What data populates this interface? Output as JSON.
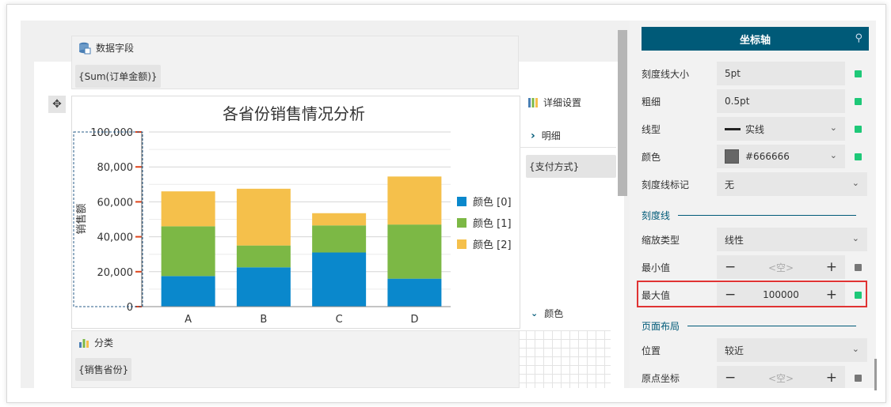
{
  "data_fields": {
    "title": "数据字段",
    "chip": "{Sum(订单金额)}"
  },
  "category": {
    "title": "分类",
    "chip": "{销售省份}"
  },
  "detail": {
    "title": "详细设置",
    "row1": "明细",
    "chip": "{支付方式}",
    "row2": "颜色"
  },
  "chart_data": {
    "type": "bar",
    "stacked": true,
    "title": "各省份销售情况分析",
    "xlabel": "",
    "ylabel": "销售额",
    "categories": [
      "A",
      "B",
      "C",
      "D"
    ],
    "yticks": [
      "0",
      "20,000",
      "40,000",
      "60,000",
      "80,000",
      "100,000"
    ],
    "ylim": [
      0,
      100000
    ],
    "grid": true,
    "legend_position": "right",
    "series": [
      {
        "name": "颜色 [0]",
        "color": "#0a88cc",
        "values": [
          17500,
          22500,
          31000,
          16000
        ]
      },
      {
        "name": "颜色 [1]",
        "color": "#7cb845",
        "values": [
          28500,
          12500,
          15500,
          31000
        ]
      },
      {
        "name": "颜色 [2]",
        "color": "#f5c04b",
        "values": [
          20000,
          32500,
          7000,
          27500
        ]
      }
    ]
  },
  "props": {
    "header": "坐标轴",
    "tick_size": {
      "label": "刻度线大小",
      "value": "5pt"
    },
    "thickness": {
      "label": "粗细",
      "value": "0.5pt"
    },
    "line_type": {
      "label": "线型",
      "value": "实线"
    },
    "color": {
      "label": "颜色",
      "value": "#666666"
    },
    "tick_mark": {
      "label": "刻度线标记",
      "value": "无"
    },
    "section_scale": "刻度线",
    "scale_type": {
      "label": "缩放类型",
      "value": "线性"
    },
    "min": {
      "label": "最小值",
      "placeholder": "<空>"
    },
    "max": {
      "label": "最大值",
      "value": "100000"
    },
    "section_layout": "页面布局",
    "position": {
      "label": "位置",
      "value": "较近"
    },
    "origin": {
      "label": "原点坐标",
      "placeholder": "<空>"
    }
  },
  "colors": {
    "accent": "#005a78",
    "status_green": "#1ec878",
    "highlight": "#e03333"
  }
}
